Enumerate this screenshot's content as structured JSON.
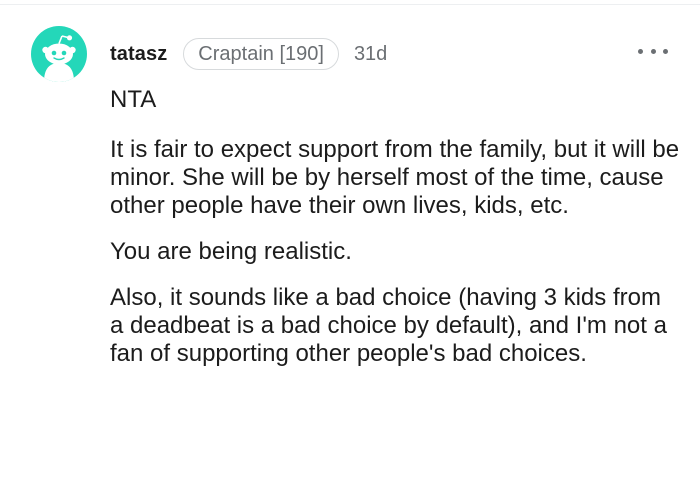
{
  "comment": {
    "username": "tatasz",
    "flair": "Craptain [190]",
    "age": "31d",
    "avatar_icon": "snoo-avatar-icon",
    "avatar_color": "#24d7b9",
    "menu_icon": "more-options-icon",
    "paragraphs": [
      "NTA",
      "It is fair to expect support from the family, but it will be minor. She will be by herself most of the time, cause other people have their own lives, kids, etc.",
      "You are being realistic.",
      "Also, it sounds like a bad choice (having 3 kids from a deadbeat is a bad choice by default), and I'm not a fan of supporting other people's bad choices."
    ]
  }
}
